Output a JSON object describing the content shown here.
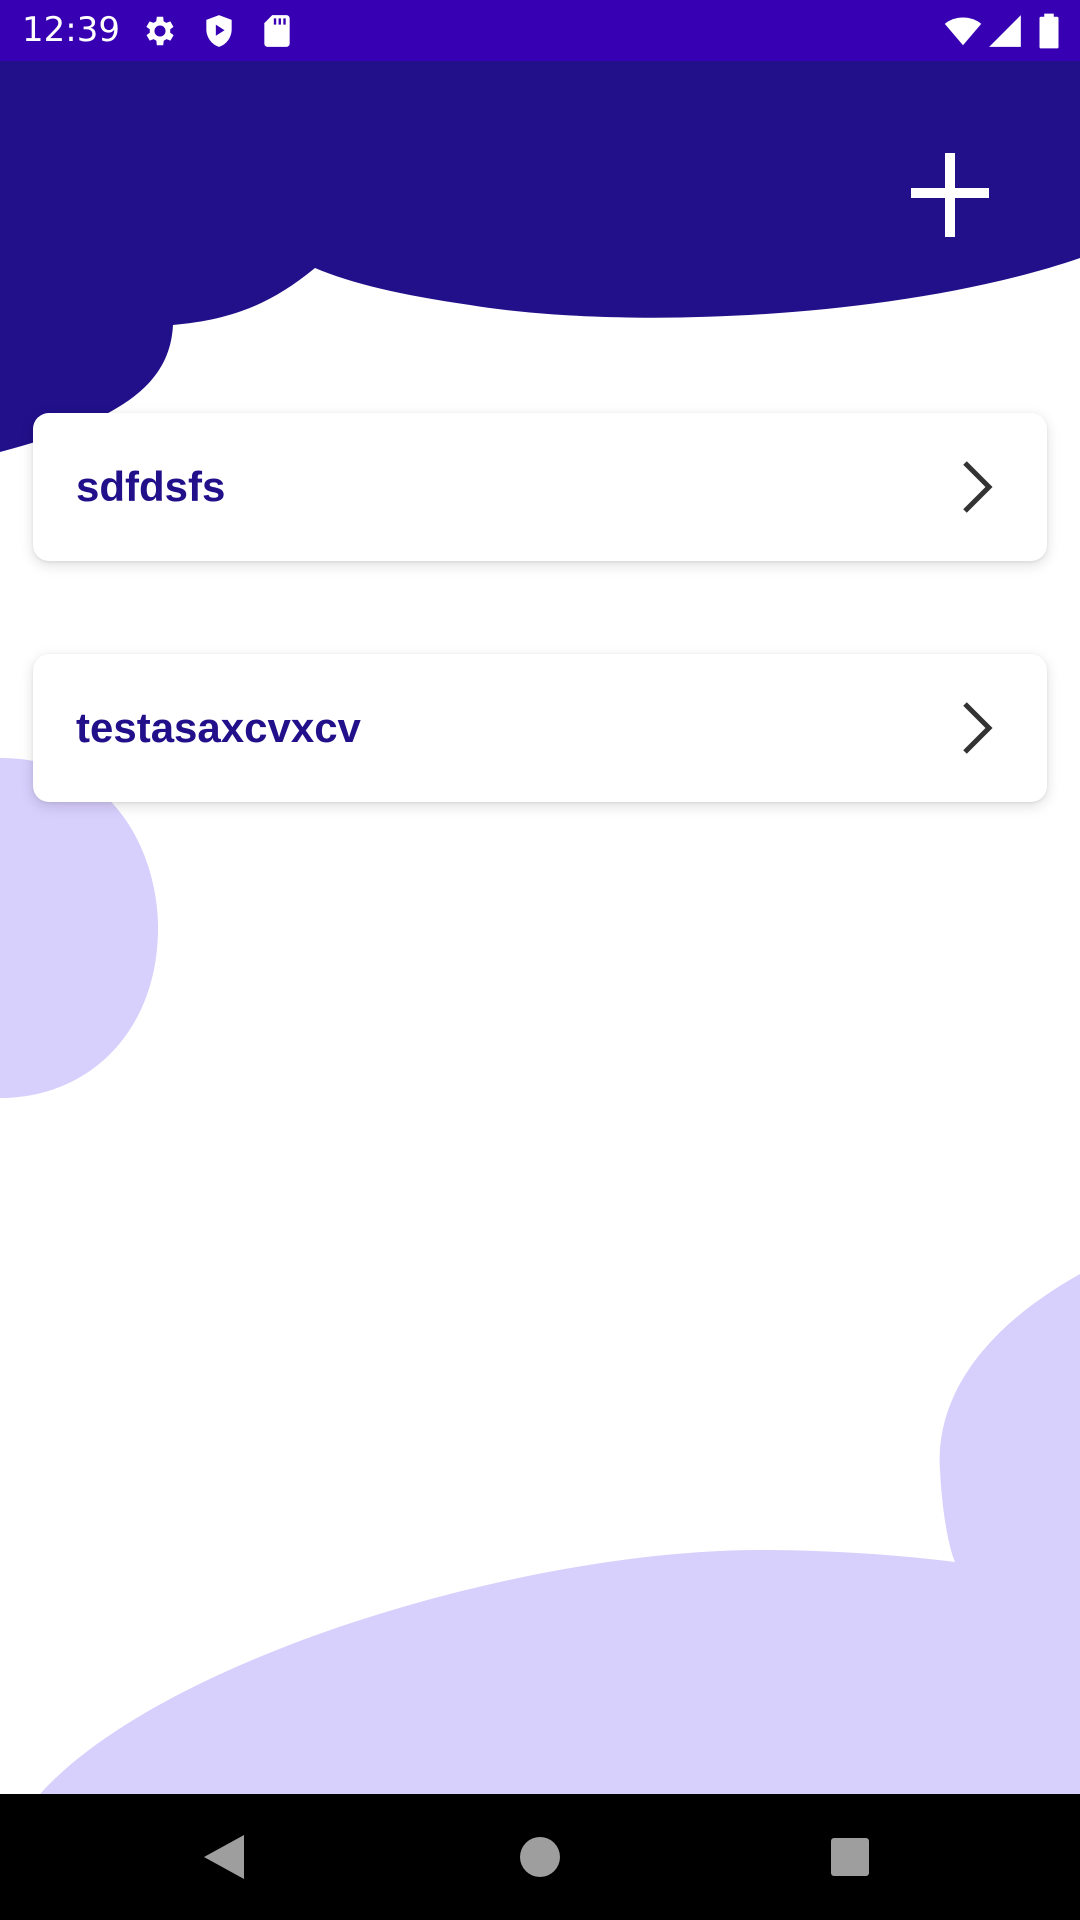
{
  "status_bar": {
    "time": "12:39",
    "background_color": "#3700b3",
    "left_icons": [
      "gear-icon",
      "shield-play-icon",
      "sd-card-icon"
    ],
    "right_icons": [
      "wifi-icon",
      "signal-icon",
      "battery-icon"
    ]
  },
  "header": {
    "add_icon": "plus-icon",
    "accent_color": "#21108a"
  },
  "items": [
    {
      "label": "sdfdsfs",
      "icon": "chevron-right-icon"
    },
    {
      "label": "testasaxcvxcv",
      "icon": "chevron-right-icon"
    }
  ],
  "decor": {
    "light_shape_color": "#d7cffc"
  },
  "nav_bar": {
    "buttons": [
      "back-icon",
      "home-icon",
      "recents-icon"
    ]
  }
}
